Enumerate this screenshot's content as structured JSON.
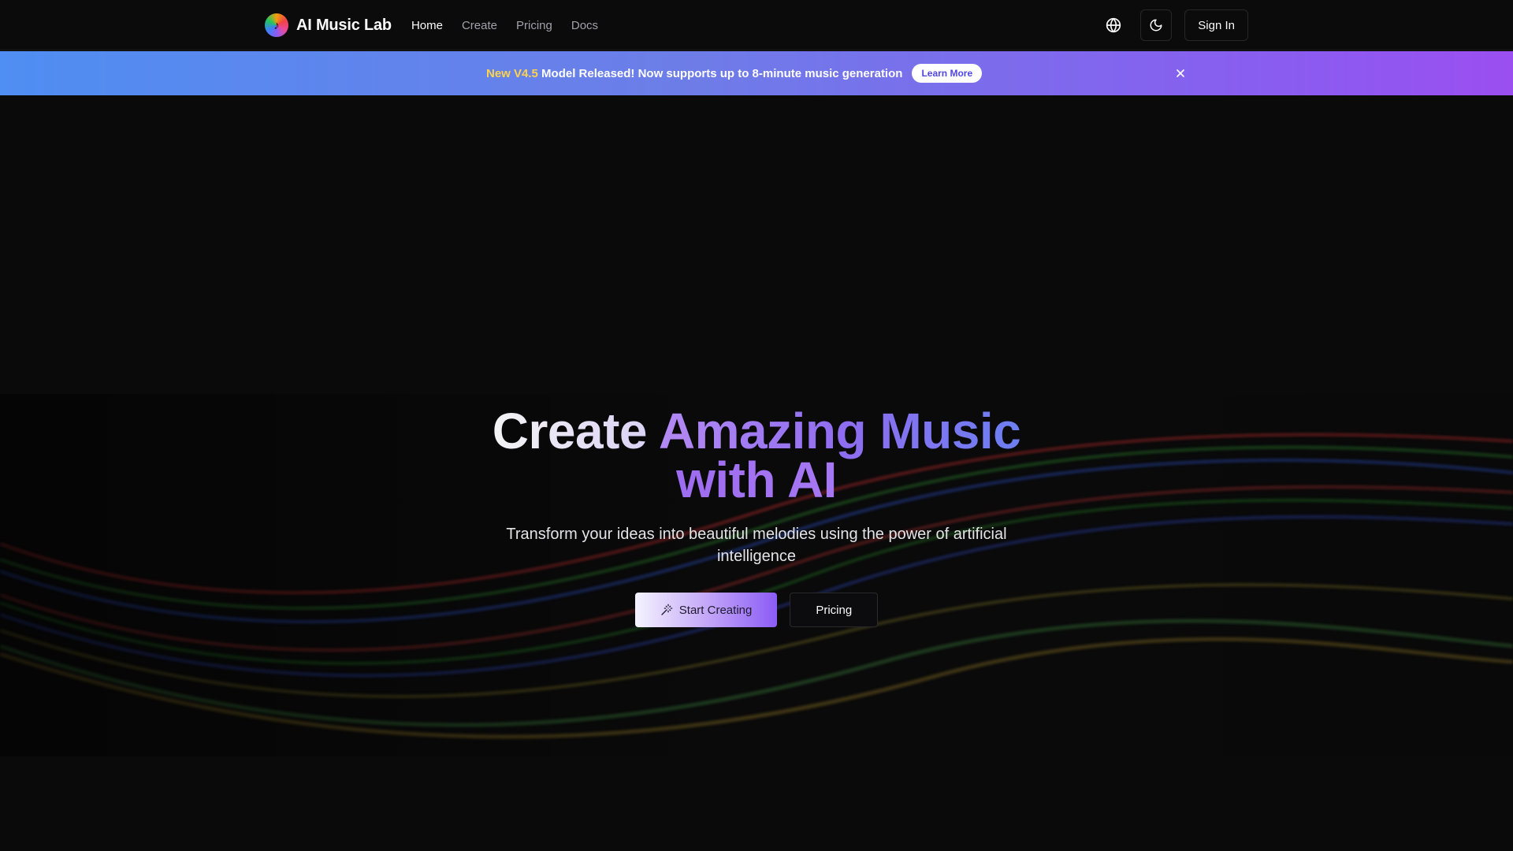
{
  "nav": {
    "brand_name": "AI Music Lab",
    "brand_icon": "music-note-icon",
    "links": [
      {
        "label": "Home",
        "active": true
      },
      {
        "label": "Create",
        "active": false
      },
      {
        "label": "Pricing",
        "active": false
      },
      {
        "label": "Docs",
        "active": false
      }
    ],
    "language_icon": "globe-icon",
    "theme_icon": "moon-icon",
    "signin_label": "Sign In"
  },
  "banner": {
    "highlight": "New V4.5",
    "message": " Model Released! Now supports up to 8-minute music generation",
    "cta_label": "Learn More",
    "close_icon": "close-icon",
    "colors": {
      "start": "#4f8ef2",
      "end": "#9b4ff0",
      "highlight": "#fcd34d"
    }
  },
  "hero": {
    "title_part1": "Create ",
    "title_part2": "Amazing Music",
    "title_line2": "with AI",
    "subtitle": "Transform your ideas into beautiful melodies using the power of artificial intelligence",
    "primary_cta": "Start Creating",
    "primary_icon": "magic-wand-icon",
    "secondary_cta": "Pricing"
  },
  "theme": {
    "background": "#0a0a0b",
    "accent": "#8b5cf6",
    "wave_colors": [
      "#7f1d1d",
      "#14532d",
      "#1e3a8a",
      "#854d0e"
    ]
  }
}
